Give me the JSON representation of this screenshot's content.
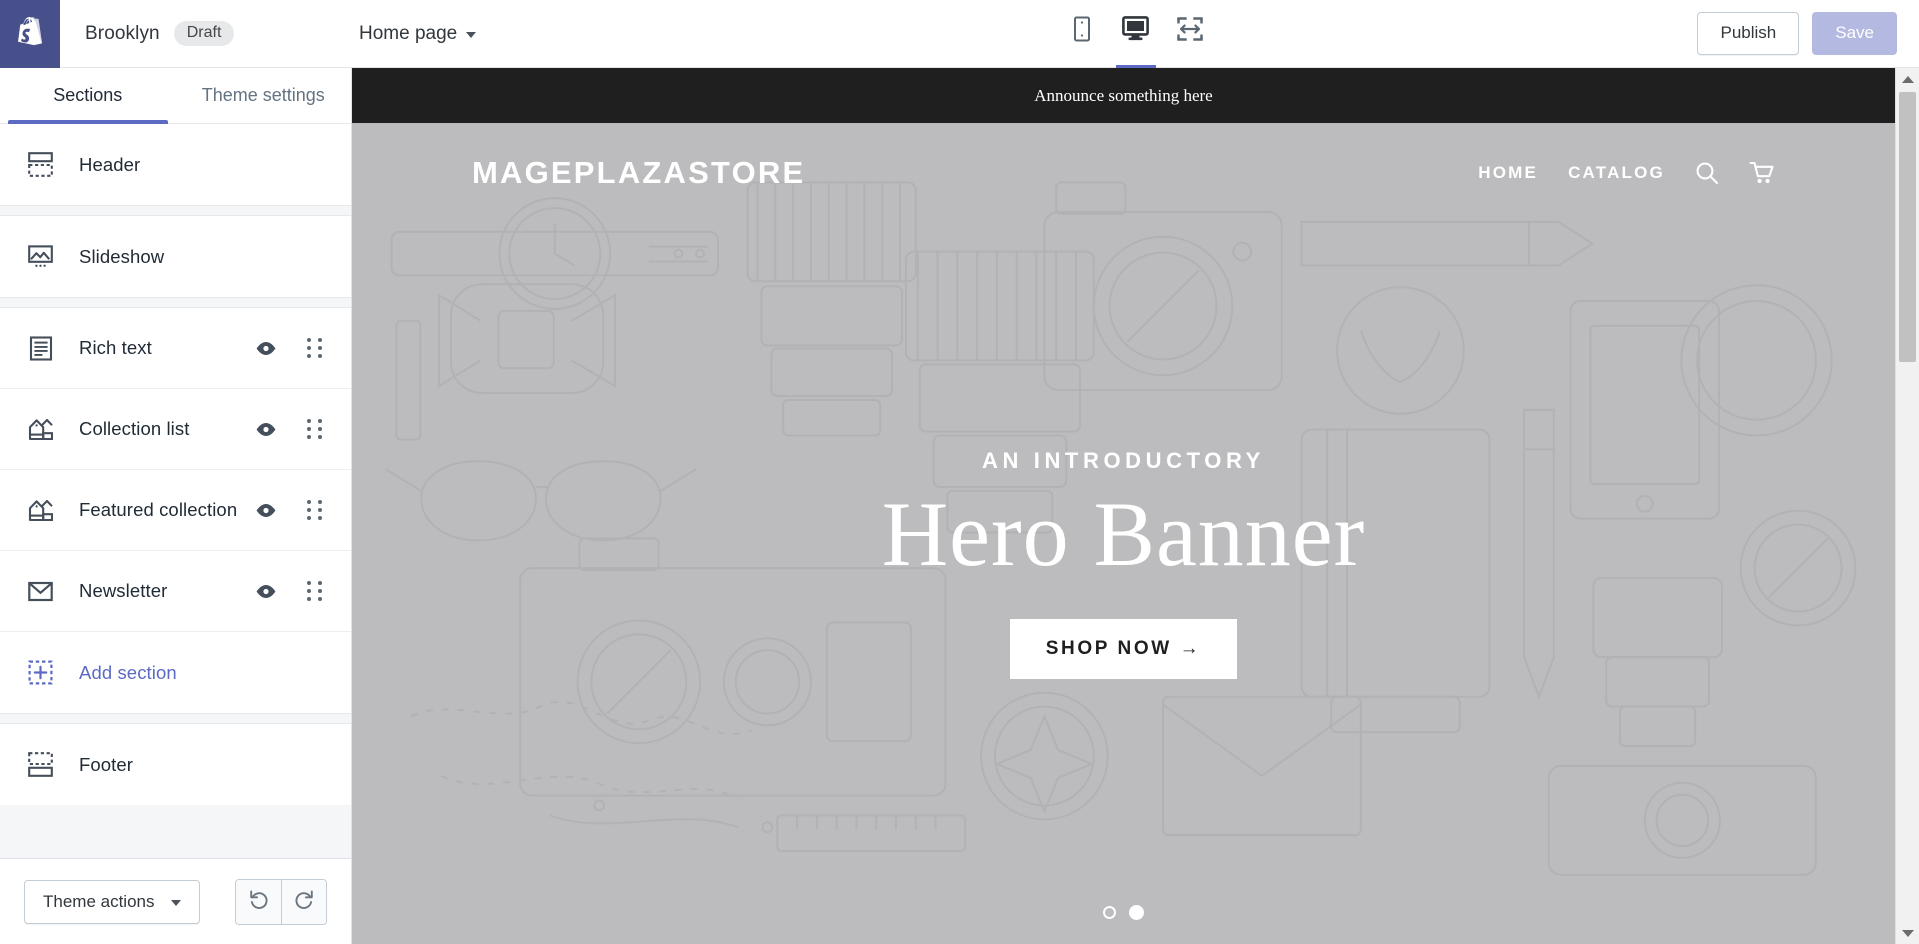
{
  "topbar": {
    "logo_icon": "shopify-bag-icon",
    "theme_name": "Brooklyn",
    "status_badge": "Draft",
    "page_selector": "Home page",
    "devices": [
      {
        "name": "mobile",
        "icon": "mobile-icon",
        "active": false
      },
      {
        "name": "desktop",
        "icon": "desktop-icon",
        "active": true
      },
      {
        "name": "fullscreen",
        "icon": "fullscreen-icon",
        "active": false
      }
    ],
    "publish_label": "Publish",
    "save_label": "Save",
    "save_disabled": true
  },
  "sidebar": {
    "tabs": [
      {
        "label": "Sections",
        "active": true
      },
      {
        "label": "Theme settings",
        "active": false
      }
    ],
    "groups": [
      {
        "items": [
          {
            "label": "Header",
            "icon": "header-layout-icon",
            "eye": false,
            "drag": false
          }
        ]
      },
      {
        "items": [
          {
            "label": "Slideshow",
            "icon": "image-icon",
            "eye": false,
            "drag": false
          }
        ]
      },
      {
        "items": [
          {
            "label": "Rich text",
            "icon": "rich-text-icon",
            "eye": true,
            "drag": true
          },
          {
            "label": "Collection list",
            "icon": "collection-icon",
            "eye": true,
            "drag": true
          },
          {
            "label": "Featured collection",
            "icon": "collection-icon",
            "eye": true,
            "drag": true
          },
          {
            "label": "Newsletter",
            "icon": "envelope-icon",
            "eye": true,
            "drag": true
          },
          {
            "label": "Add section",
            "icon": "add-section-icon",
            "eye": false,
            "drag": false,
            "accent": true
          }
        ]
      },
      {
        "items": [
          {
            "label": "Footer",
            "icon": "footer-layout-icon",
            "eye": false,
            "drag": false
          }
        ]
      }
    ],
    "footer": {
      "theme_actions_label": "Theme actions",
      "undo_icon": "undo-icon",
      "redo_icon": "redo-icon"
    }
  },
  "preview": {
    "announcement": "Announce something here",
    "store": {
      "logo": "MAGEPLAZASTORE",
      "nav": [
        {
          "label": "HOME"
        },
        {
          "label": "CATALOG"
        }
      ],
      "search_icon": "search-icon",
      "cart_icon": "cart-icon"
    },
    "hero": {
      "kicker": "AN INTRODUCTORY",
      "title": "Hero Banner",
      "cta": "SHOP NOW  →",
      "slides": [
        {
          "active": false
        },
        {
          "active": true
        }
      ]
    }
  },
  "colors": {
    "brand_purple": "#5c6ac4",
    "logo_bg": "#47508a",
    "save_disabled": "#b4b9e2",
    "announce_bg": "#1f1f1f",
    "hero_bg": "#bcbcbe",
    "text_dark": "#212b36",
    "text_muted": "#637381"
  }
}
